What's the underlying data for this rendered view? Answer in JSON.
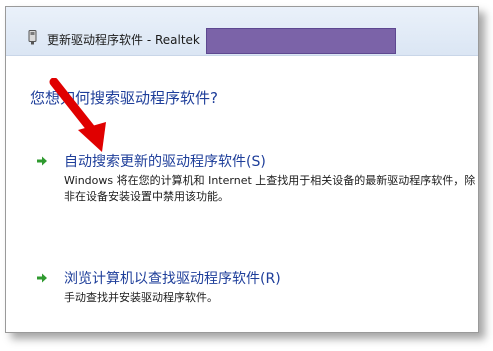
{
  "window": {
    "title": "更新驱动程序软件 - Realtek"
  },
  "main": {
    "question": "您想如何搜索驱动程序软件?",
    "options": [
      {
        "label": "自动搜索更新的驱动程序软件(S)",
        "description": "Windows 将在您的计算机和 Internet 上查找用于相关设备的最新驱动程序软件，除非在设备安装设置中禁用该功能。"
      },
      {
        "label": "浏览计算机以查找驱动程序软件(R)",
        "description": "手动查找并安装驱动程序软件。"
      }
    ]
  },
  "colors": {
    "link": "#1e3e9a",
    "arrow_green": "#2f9a2f",
    "annotation_red": "#e00000",
    "redaction": "#7b63a8"
  },
  "icons": [
    "device-icon",
    "green-arrow-icon",
    "red-annotation-arrow"
  ]
}
